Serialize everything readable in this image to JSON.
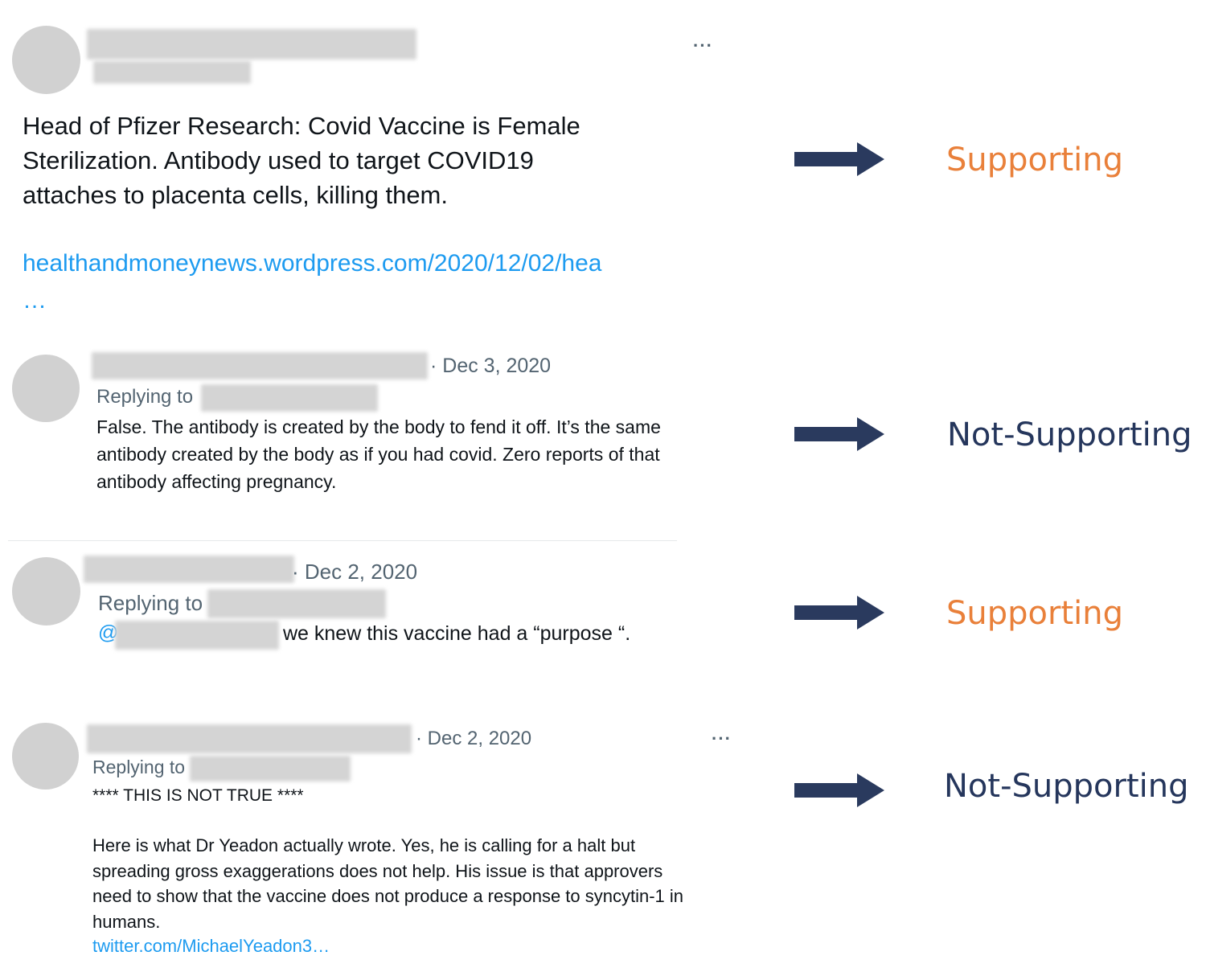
{
  "main_tweet": {
    "text_lines": [
      "Head of Pfizer Research: Covid Vaccine is Female",
      "Sterilization. Antibody used to target COVID19",
      "attaches to placenta cells, killing them."
    ],
    "link": "healthandmoneynews.wordpress.com/2020/12/02/hea",
    "link_ellipsis": "…",
    "more": "···",
    "classification": "Supporting"
  },
  "replies": [
    {
      "date": "· Dec 3, 2020",
      "replying_to": "Replying to",
      "lines": [
        "False.  The antibody is created by the body to fend it off.  It’s the same",
        "antibody created by the body as if you had covid.  Zero reports of that",
        "antibody affecting pregnancy."
      ],
      "classification": "Not-Supporting"
    },
    {
      "date": "· Dec 2, 2020",
      "replying_to": "Replying to",
      "mention_prefix": "@",
      "text": "we knew this vaccine had a “purpose “.",
      "classification": "Supporting"
    },
    {
      "date": "· Dec 2, 2020",
      "replying_to": "Replying to",
      "more": "···",
      "headline": "**** THIS IS NOT TRUE ****",
      "lines": [
        "Here is what Dr Yeadon actually wrote. Yes, he is calling for a halt but",
        "spreading gross exaggerations does not help. His issue is that approvers",
        "need to show that the vaccine does not produce a response to syncytin-1 in",
        "humans."
      ],
      "link": "twitter.com/MichaelYeadon3…",
      "classification": "Not-Supporting"
    }
  ],
  "colors": {
    "supporting": "#e9803a",
    "not_supporting": "#25365c",
    "arrow": "#2a3a5e",
    "link": "#1d9bf0",
    "meta": "#536471"
  },
  "icons": [
    "avatar-placeholder",
    "more-horizontal-icon",
    "right-arrow-icon"
  ]
}
